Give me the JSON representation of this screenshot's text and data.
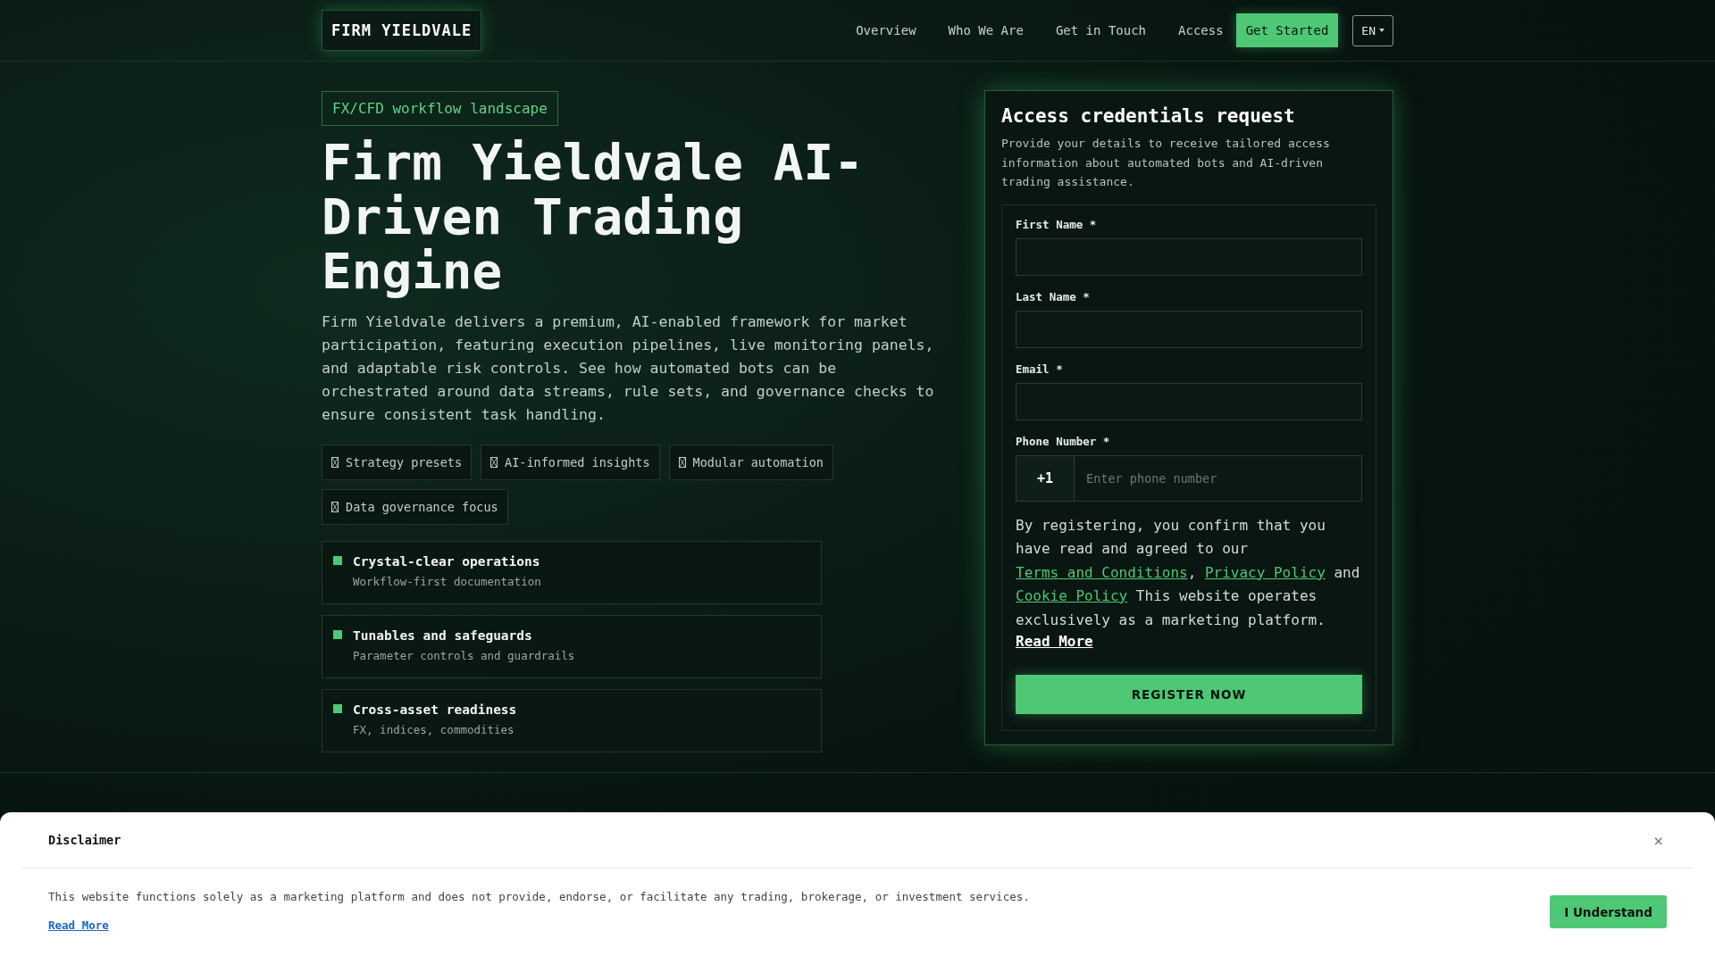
{
  "nav": {
    "brand": "FIRM YIELDVALE",
    "links": [
      "Overview",
      "Who We Are",
      "Get in Touch",
      "Access"
    ],
    "cta": "Get Started",
    "language": "EN"
  },
  "hero": {
    "tag": "FX/CFD workflow landscape",
    "title": "Firm Yieldvale AI-Driven Trading Engine",
    "description": "Firm Yieldvale delivers a premium, AI-enabled framework for market participation, featuring execution pipelines, live monitoring panels, and adaptable risk controls. See how automated bots can be orchestrated around data streams, rule sets, and governance checks to ensure consistent task handling.",
    "chips": [
      "Strategy presets",
      "AI-informed insights",
      "Modular automation",
      "Data governance focus"
    ],
    "features": [
      {
        "title": "Crystal-clear operations",
        "subtitle": "Workflow-first documentation"
      },
      {
        "title": "Tunables and safeguards",
        "subtitle": "Parameter controls and guardrails"
      },
      {
        "title": "Cross-asset readiness",
        "subtitle": "FX, indices, commodities"
      }
    ]
  },
  "form": {
    "title": "Access credentials request",
    "description": "Provide your details to receive tailored access information about automated bots and AI-driven trading assistance.",
    "fields": [
      {
        "label": "First Name *"
      },
      {
        "label": "Last Name *"
      },
      {
        "label": "Email *"
      }
    ],
    "phone": {
      "label": "Phone Number *",
      "code": "+1",
      "placeholder": "Enter phone number"
    },
    "consent": [
      {
        "kind": "text",
        "text": "By registering, you confirm that you have read and agreed to our "
      },
      {
        "kind": "link",
        "text": "Terms and Conditions"
      },
      {
        "kind": "text",
        "text": ", "
      },
      {
        "kind": "link",
        "text": "Privacy Policy"
      },
      {
        "kind": "text",
        "text": " and "
      },
      {
        "kind": "link",
        "text": "Cookie Policy"
      },
      {
        "kind": "text",
        "text": " This website operates exclusively as a marketing platform."
      }
    ],
    "read_more": "Read More",
    "submit": "REGISTER NOW"
  },
  "disclaimer": {
    "title": "Disclaimer",
    "close": "×",
    "text": "This website functions solely as a marketing platform and does not provide, endorse, or facilitate any trading, brokerage, or investment services.",
    "read_more": "Read More",
    "accept": "I Understand"
  }
}
